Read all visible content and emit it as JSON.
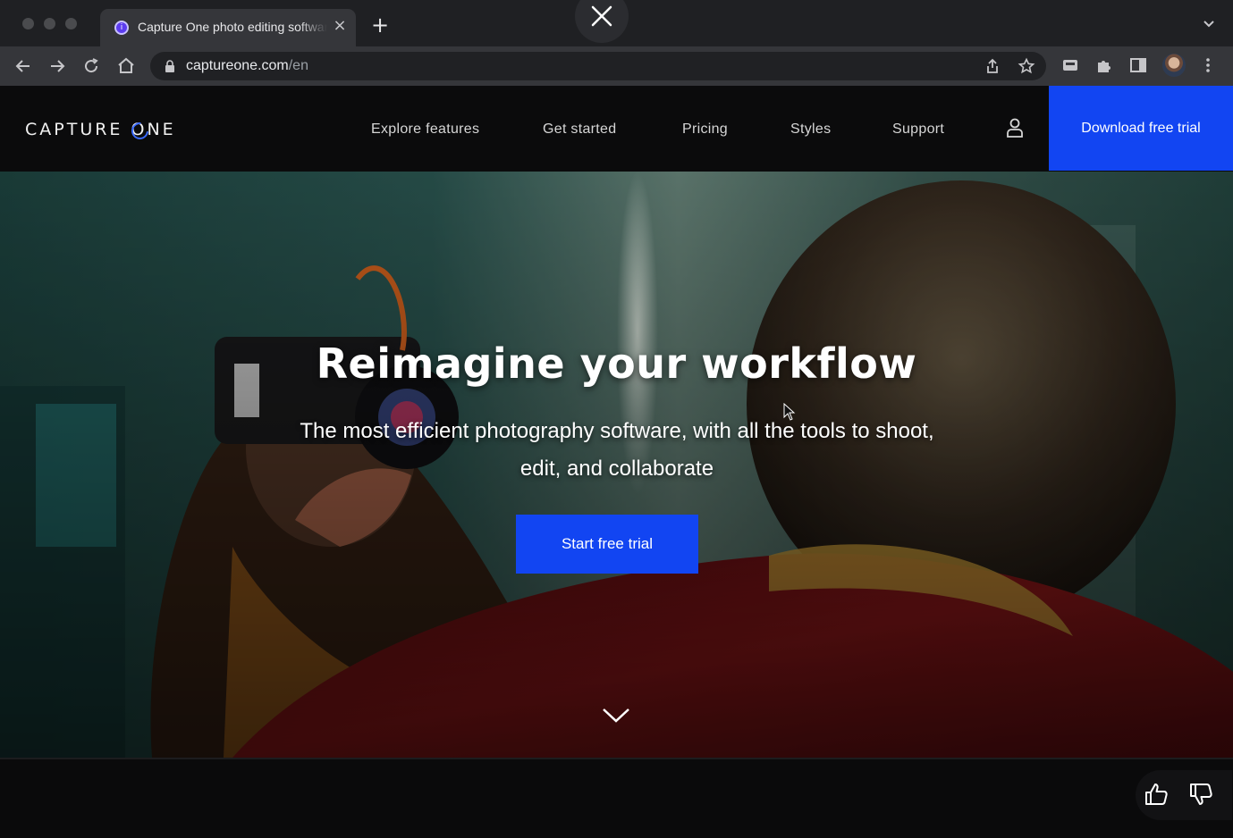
{
  "browser": {
    "tab_title": "Capture One photo editing software",
    "tab_close": "×",
    "new_tab": "+",
    "url_domain": "captureone.com",
    "url_path": "/en"
  },
  "site": {
    "logo_pre": "CAPTURE ",
    "logo_o": "O",
    "logo_post": "NE",
    "nav": {
      "explore": "Explore features",
      "get_started": "Get started",
      "pricing": "Pricing",
      "styles": "Styles",
      "support": "Support"
    },
    "download_cta": "Download free trial"
  },
  "hero": {
    "title": "Reimagine your workflow",
    "subtitle": "The most efficient photography software, with all the tools to shoot, edit, and collaborate",
    "cta": "Start free trial"
  },
  "colors": {
    "accent": "#1245f2",
    "header_bg": "#0b0b0c",
    "chrome_bg": "#35363a"
  }
}
